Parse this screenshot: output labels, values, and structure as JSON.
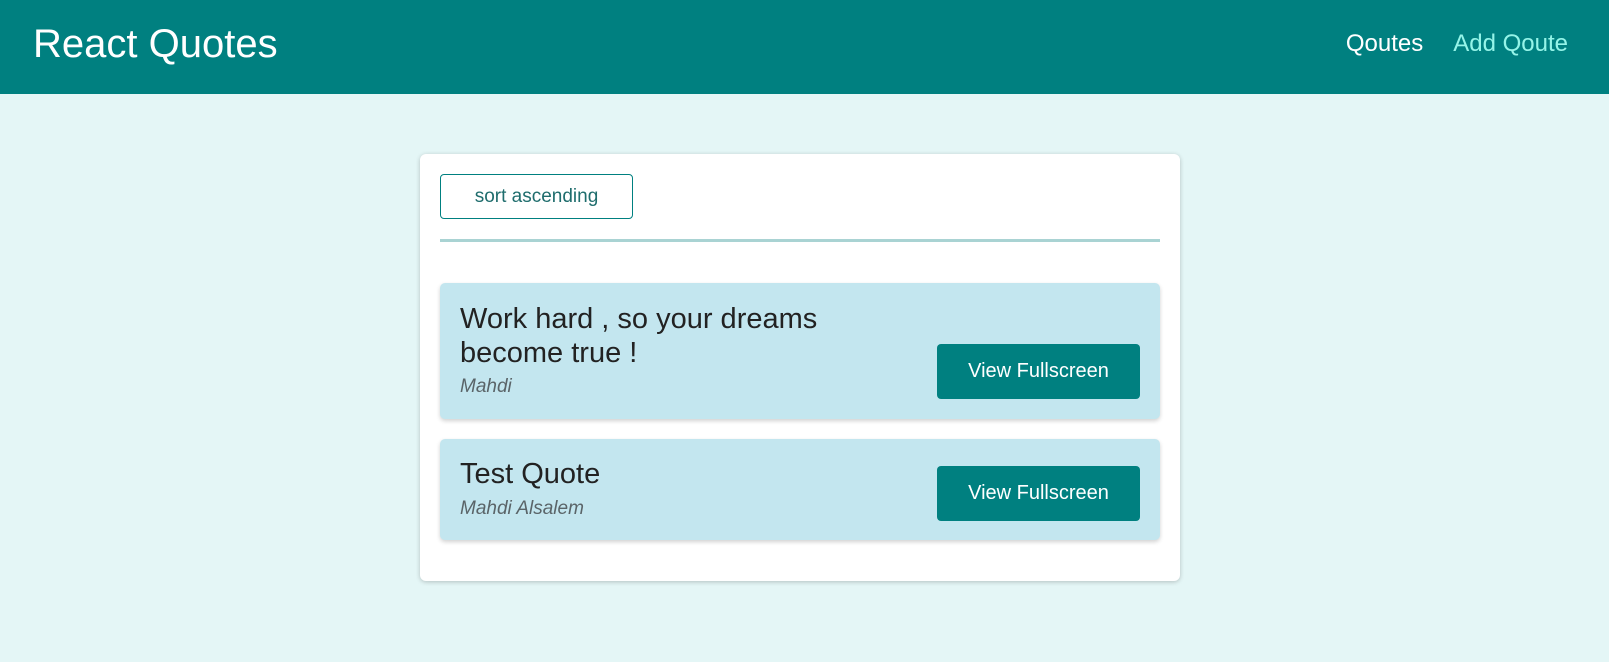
{
  "header": {
    "brand": "React Quotes",
    "nav": [
      {
        "label": "Qoutes",
        "active": true
      },
      {
        "label": "Add Qoute",
        "active": false
      }
    ]
  },
  "toolbar": {
    "sort_label": "sort ascending"
  },
  "quotes": [
    {
      "text": "Work hard , so your dreams become true !",
      "author": "Mahdi",
      "button_label": "View Fullscreen"
    },
    {
      "text": "Test Quote",
      "author": "Mahdi Alsalem",
      "button_label": "View Fullscreen"
    }
  ],
  "colors": {
    "primary": "#008080",
    "background": "#e4f6f6",
    "card": "#c3e6ef",
    "nav_inactive": "#95f4e8"
  }
}
